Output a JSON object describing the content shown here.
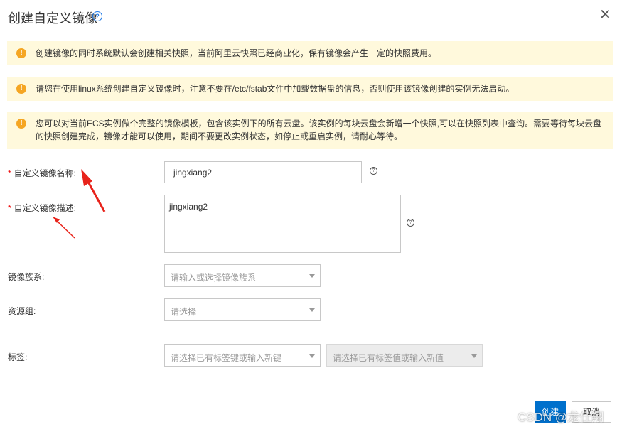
{
  "dialog": {
    "title": "创建自定义镜像",
    "help_icon": "question-circle-icon",
    "close_icon": "close-icon",
    "close_glyph": "✕"
  },
  "notices": [
    {
      "icon": "warning-icon",
      "text": "创建镜像的同时系统默认会创建相关快照，当前阿里云快照已经商业化，保有镜像会产生一定的快照费用。"
    },
    {
      "icon": "warning-icon",
      "text": "请您在使用linux系统创建自定义镜像时，注意不要在/etc/fstab文件中加载数据盘的信息，否则使用该镜像创建的实例无法启动。"
    },
    {
      "icon": "warning-icon",
      "text": "您可以对当前ECS实例做个完整的镜像模板，包含该实例下的所有云盘。该实例的每块云盘会新增一个快照,可以在快照列表中查询。需要等待每块云盘的快照创建完成，镜像才能可以使用，期间不要更改实例状态，如停止或重启实例，请耐心等待。"
    }
  ],
  "form": {
    "required_mark": "*",
    "name": {
      "label": "自定义镜像名称:",
      "value": "jingxiang2"
    },
    "description": {
      "label": "自定义镜像描述:",
      "value": "jingxiang2"
    },
    "family": {
      "label": "镜像族系:",
      "placeholder": "请输入或选择镜像族系"
    },
    "resource_group": {
      "label": "资源组:",
      "placeholder": "请选择"
    },
    "tags": {
      "label": "标签:",
      "key_placeholder": "请选择已有标签键或输入新键",
      "value_placeholder": "请选择已有标签值或输入新值"
    }
  },
  "buttons": {
    "create": "创建",
    "cancel": "取消"
  },
  "watermark": "CSDN @龙仕翔",
  "colors": {
    "primary": "#0070cc",
    "notice_bg": "#fff9dc",
    "warning": "#f5a623",
    "annotation": "#e8231b"
  }
}
